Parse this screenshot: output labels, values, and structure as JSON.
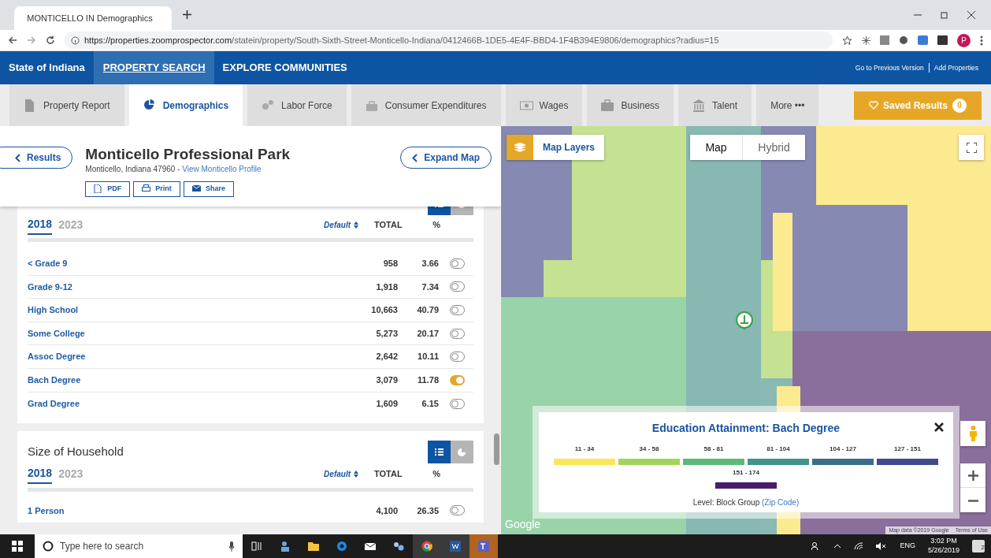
{
  "browser": {
    "tab_title": "MONTICELLO IN Demographics",
    "url_host": "https://properties.zoomprospector.com",
    "url_path": "/statein/property/South-Sixth-Street-Monticello-Indiana/0412466B-1DE5-4E4F-BBD4-1F4B394E9806/demographics?radius=15",
    "profile_letter": "P"
  },
  "nav": {
    "brand": "State of Indiana",
    "links": [
      {
        "label": "PROPERTY SEARCH",
        "selected": true
      },
      {
        "label": "EXPLORE COMMUNITIES",
        "selected": false
      }
    ],
    "right_links": [
      "Go to Previous Version",
      "Add Properties"
    ]
  },
  "section_tabs": [
    {
      "label": "Property Report",
      "kind": "document",
      "selected": false
    },
    {
      "label": "Demographics",
      "kind": "pie",
      "selected": true
    },
    {
      "label": "Labor Force",
      "kind": "gears",
      "selected": false
    },
    {
      "label": "Consumer Expenditures",
      "kind": "bag",
      "selected": false
    },
    {
      "label": "Wages",
      "kind": "money",
      "selected": false
    },
    {
      "label": "Business",
      "kind": "briefcase",
      "selected": false
    },
    {
      "label": "Talent",
      "kind": "building",
      "selected": false
    },
    {
      "label": "More •••",
      "kind": "menu",
      "selected": false
    }
  ],
  "saved_results": {
    "label": "Saved Results",
    "count": "0"
  },
  "property": {
    "results_button": "Results",
    "title": "Monticello Professional Park",
    "address": "Monticello, Indiana 47960 - ",
    "profile_link": "View Monticello Profile",
    "expand_button": "Expand Map",
    "actions": [
      {
        "label": "PDF",
        "kind": "file"
      },
      {
        "label": "Print",
        "kind": "printer"
      },
      {
        "label": "Share",
        "kind": "mail"
      }
    ]
  },
  "sections": [
    {
      "views": [
        {
          "kind": "table",
          "selected": true
        },
        {
          "kind": "pie",
          "selected": false
        }
      ],
      "years": [
        {
          "label": "2018",
          "selected": true
        },
        {
          "label": "2023",
          "selected": false
        }
      ],
      "sort_label": "Default",
      "columns": [
        "TOTAL",
        "%"
      ],
      "rows": [
        {
          "label": "< Grade 9",
          "total": "958",
          "pct": "3.66",
          "on": false
        },
        {
          "label": "Grade 9-12",
          "total": "1,918",
          "pct": "7.34",
          "on": false
        },
        {
          "label": "High School",
          "total": "10,663",
          "pct": "40.79",
          "on": false
        },
        {
          "label": "Some College",
          "total": "5,273",
          "pct": "20.17",
          "on": false
        },
        {
          "label": "Assoc Degree",
          "total": "2,642",
          "pct": "10.11",
          "on": false
        },
        {
          "label": "Bach Degree",
          "total": "3,079",
          "pct": "11.78",
          "on": true
        },
        {
          "label": "Grad Degree",
          "total": "1,609",
          "pct": "6.15",
          "on": false
        }
      ]
    },
    {
      "title": "Size of Household",
      "views": [
        {
          "kind": "table",
          "selected": true
        },
        {
          "kind": "pie",
          "selected": false
        }
      ],
      "years": [
        {
          "label": "2018",
          "selected": true
        },
        {
          "label": "2023",
          "selected": false
        }
      ],
      "sort_label": "Default",
      "columns": [
        "TOTAL",
        "%"
      ],
      "rows": [
        {
          "label": "1 Person",
          "total": "4,100",
          "pct": "26.35",
          "on": false
        }
      ]
    }
  ],
  "map": {
    "layers_button": "Map Layers",
    "map_types": [
      {
        "label": "Map",
        "selected": true
      },
      {
        "label": "Hybrid",
        "selected": false
      }
    ],
    "legend": {
      "title": "Education Attainment: Bach Degree",
      "ranges": [
        {
          "label": "11 - 34",
          "color": "#fbe55a"
        },
        {
          "label": "34 - 58",
          "color": "#a3d45a"
        },
        {
          "label": "58 - 81",
          "color": "#5db97a"
        },
        {
          "label": "81 - 104",
          "color": "#42938a"
        },
        {
          "label": "104 - 127",
          "color": "#3b6d8c"
        },
        {
          "label": "127 - 151",
          "color": "#404a8a"
        },
        {
          "label": "151 - 174",
          "color": "#461d67"
        }
      ],
      "level_label": "Level: Block Group",
      "level_link": "(Zip Code)"
    },
    "logo": "Google",
    "map_data": "Map data ©2019 Google",
    "terms": "Terms of Use"
  },
  "taskbar": {
    "search_placeholder": "Type here to search",
    "language": "ENG",
    "time": "3:02 PM",
    "date": "5/26/2019",
    "notifications": "2"
  }
}
